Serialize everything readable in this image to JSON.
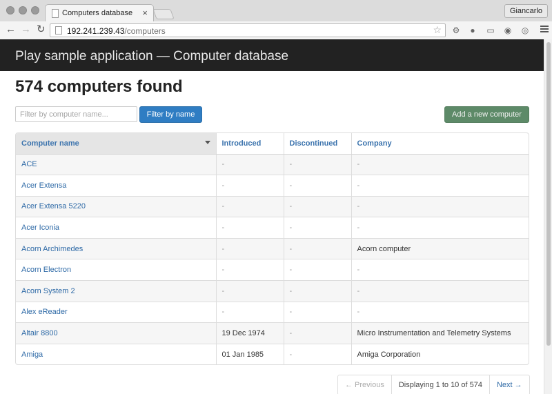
{
  "browser": {
    "tab_title": "Computers database",
    "user": "Giancarlo",
    "url_host": "192.241.239.43",
    "url_path": "/computers"
  },
  "app": {
    "brand": "Play sample application — Computer database",
    "heading": "574 computers found",
    "filter_placeholder": "Filter by computer name...",
    "filter_button": "Filter by name",
    "add_button": "Add a new computer"
  },
  "table": {
    "columns": [
      "Computer name",
      "Introduced",
      "Discontinued",
      "Company"
    ],
    "rows": [
      {
        "name": "ACE",
        "introduced": "-",
        "discontinued": "-",
        "company": "-"
      },
      {
        "name": "Acer Extensa",
        "introduced": "-",
        "discontinued": "-",
        "company": "-"
      },
      {
        "name": "Acer Extensa 5220",
        "introduced": "-",
        "discontinued": "-",
        "company": "-"
      },
      {
        "name": "Acer Iconia",
        "introduced": "-",
        "discontinued": "-",
        "company": "-"
      },
      {
        "name": "Acorn Archimedes",
        "introduced": "-",
        "discontinued": "-",
        "company": "Acorn computer"
      },
      {
        "name": "Acorn Electron",
        "introduced": "-",
        "discontinued": "-",
        "company": "-"
      },
      {
        "name": "Acorn System 2",
        "introduced": "-",
        "discontinued": "-",
        "company": "-"
      },
      {
        "name": "Alex eReader",
        "introduced": "-",
        "discontinued": "-",
        "company": "-"
      },
      {
        "name": "Altair 8800",
        "introduced": "19 Dec 1974",
        "discontinued": "-",
        "company": "Micro Instrumentation and Telemetry Systems"
      },
      {
        "name": "Amiga",
        "introduced": "01 Jan 1985",
        "discontinued": "-",
        "company": "Amiga Corporation"
      }
    ]
  },
  "pagination": {
    "prev": "← Previous",
    "info": "Displaying 1 to 10 of 574",
    "next": "Next →"
  },
  "icons": {
    "back": "back-arrow-icon",
    "forward": "forward-arrow-icon",
    "reload": "reload-icon",
    "bookmark": "star-icon",
    "menu": "hamburger-menu-icon",
    "sort": "sort-caret-icon"
  },
  "colors": {
    "navbar": "#222222",
    "link": "#2d69a6",
    "primary_button": "#2f7dc3",
    "success_button": "#5d8a68"
  }
}
